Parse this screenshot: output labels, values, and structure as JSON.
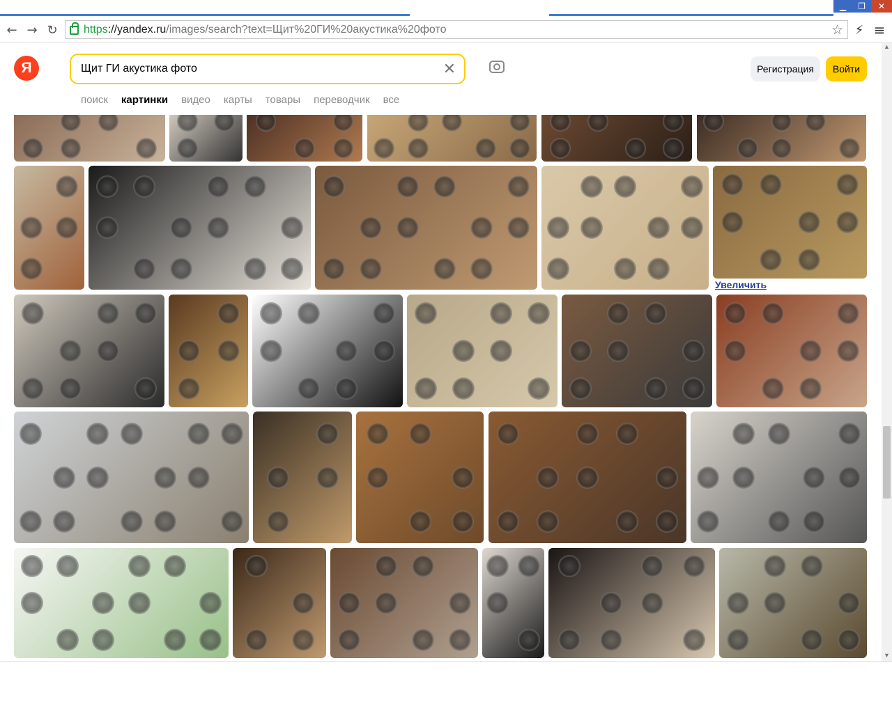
{
  "window": {
    "min_glyph": "▁",
    "max_glyph": "❐",
    "close_glyph": "✕"
  },
  "browser": {
    "url_scheme": "https",
    "url_host": "://yandex.ru",
    "url_rest": "/images/search?text=Щит%20ГИ%20акустика%20фото",
    "back_glyph": "←",
    "forward_glyph": "→",
    "reload_glyph": "↻",
    "bookmark_glyph": "☆",
    "ext_glyph": "⚡",
    "menu_glyph": "≡"
  },
  "header": {
    "logo_letter": "Я",
    "search_value": "Щит ГИ акустика фото",
    "clear_glyph": "✕",
    "register_label": "Регистрация",
    "login_label": "Войти",
    "tabs": [
      {
        "label": "поиск"
      },
      {
        "label": "картинки"
      },
      {
        "label": "видео"
      },
      {
        "label": "карты"
      },
      {
        "label": "товары"
      },
      {
        "label": "переводчик"
      },
      {
        "label": "все"
      }
    ]
  },
  "results": {
    "enlarge_label": "Увеличить"
  },
  "colors": {
    "accent": "#ffcc00",
    "logo": "#fc3f1d",
    "url_secure": "#1e9e3e"
  }
}
